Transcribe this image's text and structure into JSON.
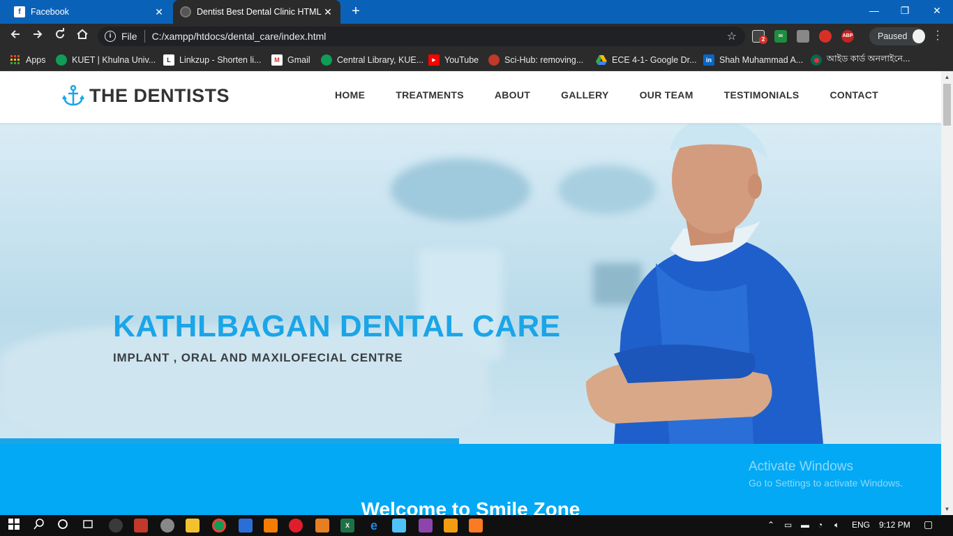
{
  "browser": {
    "tabs": [
      {
        "label": "Facebook",
        "active": false,
        "icon": "facebook-icon"
      },
      {
        "label": "Dentist Best Dental Clinic HTML V",
        "active": true,
        "icon": "globe-icon"
      }
    ],
    "new_tab": "+",
    "window_controls": {
      "minimize": "—",
      "restore": "❐",
      "close": "✕"
    },
    "address": {
      "scheme": "File",
      "url": "C:/xampp/htdocs/dental_care/index.html"
    },
    "profile_status": "Paused",
    "extension_badge": "2",
    "abp_label": "ABP",
    "bookmarks": [
      {
        "label": "Apps",
        "icon": "apps-grid-icon",
        "color": "#4285f4"
      },
      {
        "label": "KUET | Khulna Univ...",
        "icon": "kuet-logo-icon",
        "color": "#0f9d58"
      },
      {
        "label": "Linkzup - Shorten li...",
        "icon": "linkzup-icon",
        "color": "#ffffff"
      },
      {
        "label": "Gmail",
        "icon": "gmail-icon",
        "color": "#d93025"
      },
      {
        "label": "Central Library, KUE...",
        "icon": "kuet-logo-icon",
        "color": "#0f9d58"
      },
      {
        "label": "YouTube",
        "icon": "youtube-icon",
        "color": "#ff0000"
      },
      {
        "label": "Sci-Hub: removing...",
        "icon": "scihub-icon",
        "color": "#c0392b"
      },
      {
        "label": "ECE 4-1- Google Dr...",
        "icon": "google-drive-icon",
        "color": "#fbbc04"
      },
      {
        "label": "Shah Muhammad A...",
        "icon": "linkedin-icon",
        "color": "#0a66c2"
      },
      {
        "label": "আইড কার্ড অনলাইনে...",
        "icon": "bd-flag-icon",
        "color": "#006a4e"
      }
    ]
  },
  "site": {
    "brand": "THE DENTISTS",
    "nav": [
      "HOME",
      "TREATMENTS",
      "ABOUT",
      "GALLERY",
      "OUR TEAM",
      "TESTIMONIALS",
      "CONTACT"
    ],
    "hero_title": "KATHLBAGAN DENTAL CARE",
    "hero_subtitle": "IMPLANT , ORAL AND MAXILOFECIAL CENTRE",
    "welcome_title": "Welcome to Smile Zone",
    "accent_color": "#03a9f4"
  },
  "watermark": {
    "line1": "Activate Windows",
    "line2": "Go to Settings to activate Windows."
  },
  "taskbar": {
    "language": "ENG",
    "time": "9:12 PM"
  }
}
